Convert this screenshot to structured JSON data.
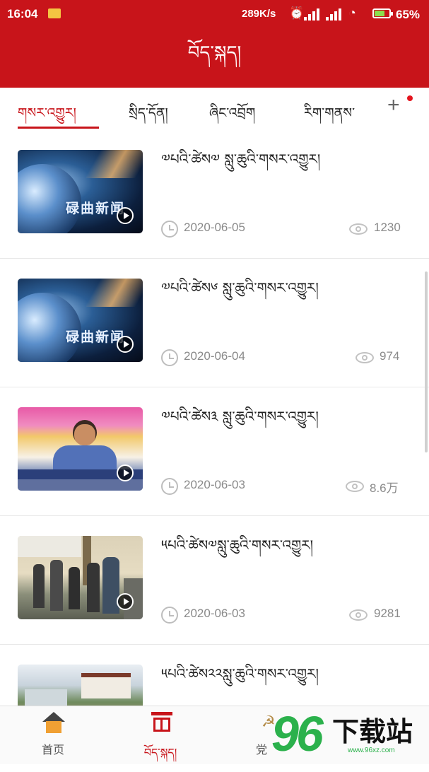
{
  "status": {
    "time": "16:04",
    "net_speed": "289K/s",
    "battery_pct": "65%",
    "battery_level": 0.65
  },
  "header": {
    "title": "བོད་སྐད།"
  },
  "tabs": [
    {
      "label": "གསར་འགྱུར།"
    },
    {
      "label": "སྲིད་དོན།"
    },
    {
      "label": "ཞིང་འབྲོག"
    },
    {
      "label": "རིག་གནས་"
    }
  ],
  "tab_add_label": "+",
  "news": [
    {
      "title": "༧པའི་ཚེས༧ སླུ་ཆུའི་གསར་འགྱུར།",
      "date": "2020-06-05",
      "views": "1230",
      "thumb_caption": "碌曲新闻"
    },
    {
      "title": "༧པའི་ཚེས༦ སླུ་ཆུའི་གསར་འགྱུར།",
      "date": "2020-06-04",
      "views": "974",
      "thumb_caption": "碌曲新闻"
    },
    {
      "title": "༧པའི་ཚེས༣ སླུ་ཆུའི་གསར་འགྱུར།",
      "date": "2020-06-03",
      "views": "8.6万",
      "thumb_caption": ""
    },
    {
      "title": "༥པའི་ཚེས༧སླུ་ཆུའི་གསར་འགྱུར།",
      "date": "2020-06-03",
      "views": "9281",
      "thumb_caption": ""
    },
    {
      "title": "༥པའི་ཚེས༢༢སླུ་ཆུའི་གསར་འགྱུར།",
      "date": "",
      "views": "",
      "thumb_caption": ""
    }
  ],
  "bottom_nav": [
    {
      "label": "首页"
    },
    {
      "label": "བོད་སྐད།"
    },
    {
      "label": "党"
    }
  ],
  "watermark": {
    "number": "96",
    "text": "下载站",
    "url": "www.96xz.com"
  },
  "colors": {
    "brand_red": "#c8141a",
    "watermark_green": "#2bb14c"
  }
}
